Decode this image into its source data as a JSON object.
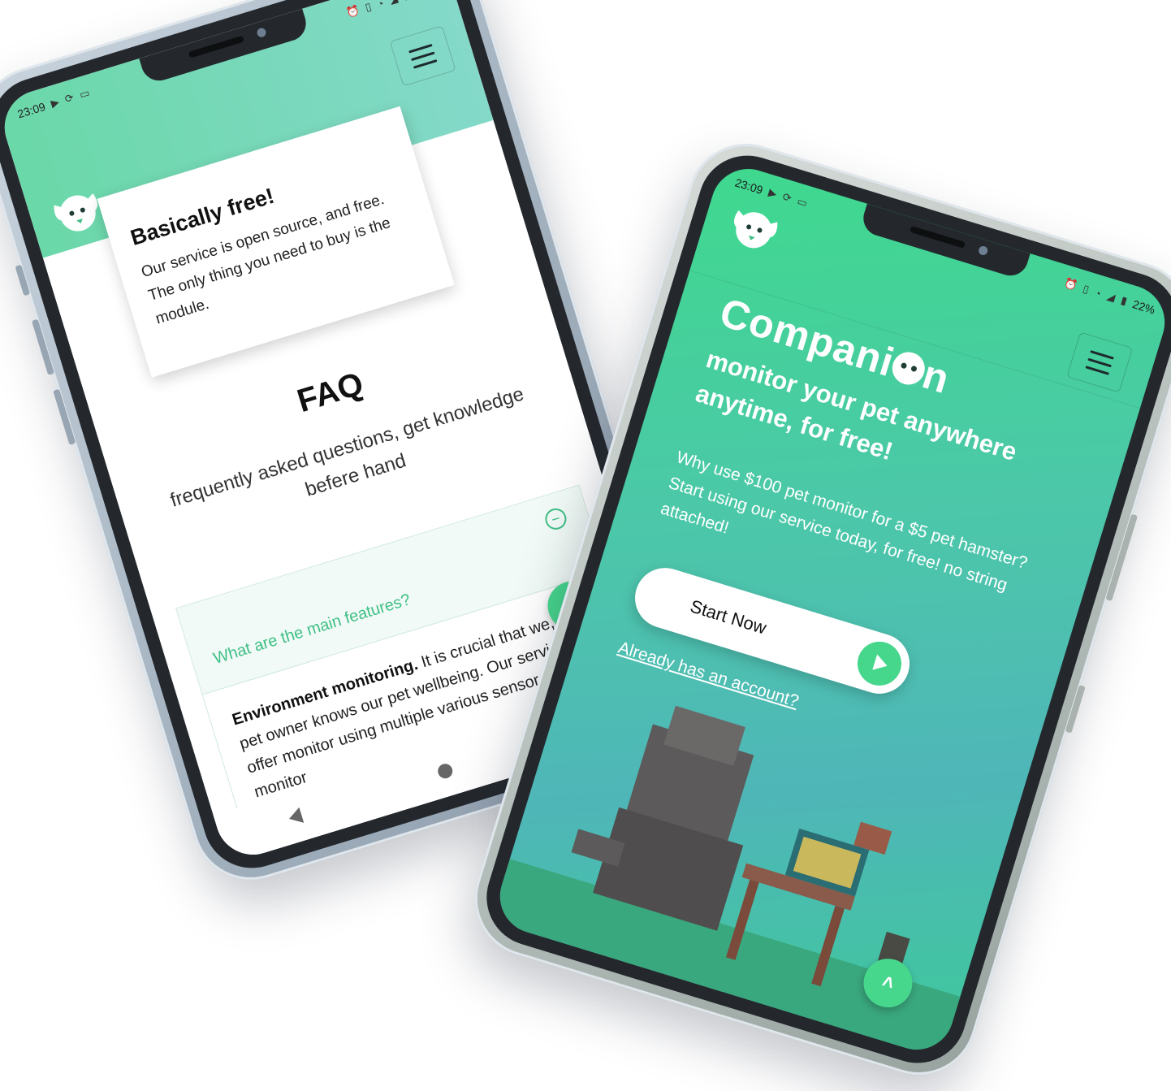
{
  "status_bar": {
    "time": "23:09",
    "battery": "22%",
    "icons": [
      "youtube-icon",
      "sync-icon",
      "laptop-icon",
      "alarm-icon",
      "vibrate-icon",
      "wifi-icon",
      "signal-icon",
      "battery-icon"
    ]
  },
  "faq_screen": {
    "card": {
      "title": "Basically free!",
      "body": "Our service is open source, and free. The only thing you need to buy is the module."
    },
    "faq_title": "FAQ",
    "faq_subtitle": "frequently asked questions, get knowledge befere hand",
    "question": "What are the main features?",
    "toggle_symbol": "−",
    "answer_bold": "Environment monitoring.",
    "answer_rest": " It is crucial that we, as a pet owner knows our pet wellbeing. Our services offer monitor using multiple various sensor to monitor",
    "fab_symbol": "˄"
  },
  "hero_screen": {
    "brand_prefix": "Compani",
    "brand_suffix": "n",
    "tagline": "monitor your pet anywhere anytime, for free!",
    "description": "Why use $100 pet monitor for a $5 pet hamster? Start using our service today, for free! no string attached!",
    "cta_label": "Start Now",
    "login_link": "Already has an account?",
    "fab_symbol": "˄"
  },
  "colors": {
    "brand_green": "#46d68c",
    "gradient_start": "#3fd98e",
    "gradient_end": "#4fb6b8",
    "faq_accent": "#3fbf86"
  }
}
